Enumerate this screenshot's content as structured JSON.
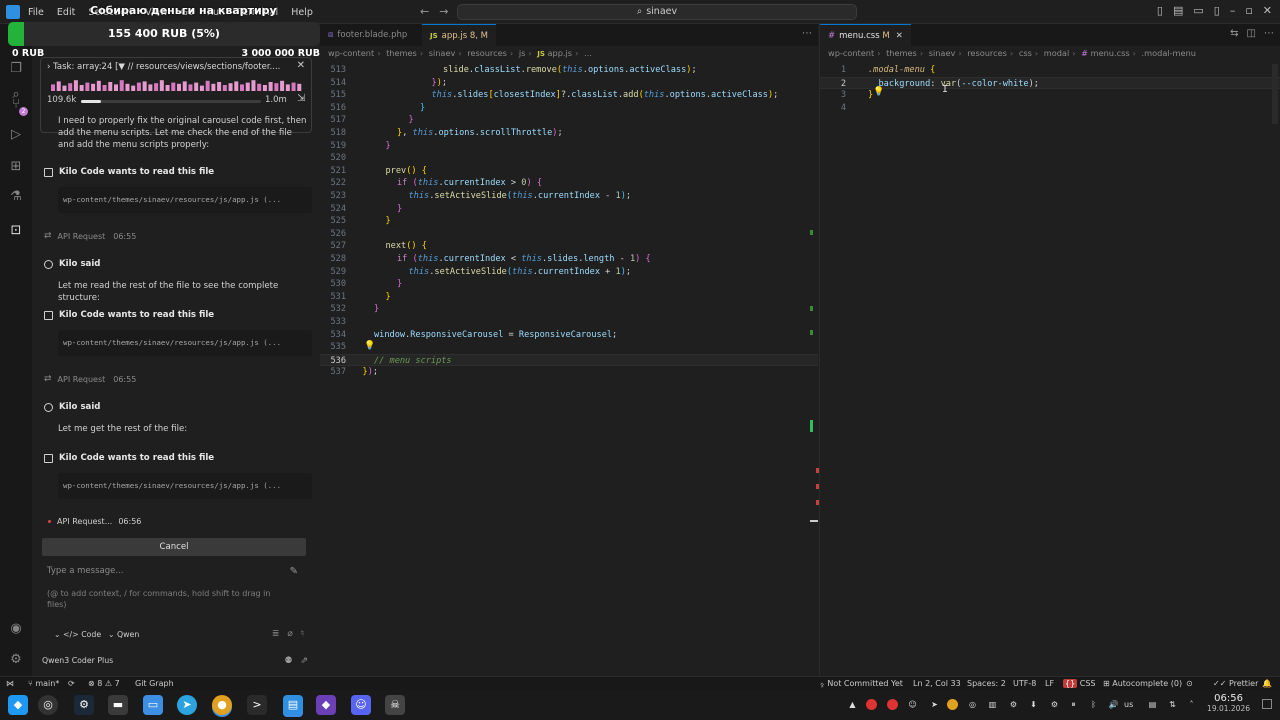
{
  "titlebar": {
    "menu": [
      "File",
      "Edit",
      "Selection",
      "View",
      "Go",
      "Run",
      "Terminal",
      "Help"
    ],
    "search": "sinaev"
  },
  "donation": {
    "title": "Собираю деньги на квартиру",
    "amount": "155 400 RUB (5%)",
    "min": "0 RUB",
    "max": "3 000 000 RUB",
    "progress": 0.052,
    "color": "#23b33a"
  },
  "activitybar": {
    "icons": [
      "kilo-code-icon",
      "explorer-icon",
      "search-icon",
      "source-control-icon",
      "run-debug-icon",
      "extensions-icon",
      "testing-icon",
      "kilo-panel-icon",
      "account-icon",
      "settings-icon"
    ],
    "source_control_badge": "2"
  },
  "task": {
    "header": "Task: array:24 [▼ // resources/views/sections/footer....",
    "context_min": "109.6k",
    "context_max": "1.0m",
    "context_fraction": 0.11,
    "histogram": [
      0.55,
      0.8,
      0.45,
      0.65,
      0.9,
      0.5,
      0.7,
      0.6,
      0.85,
      0.5,
      0.75,
      0.55,
      0.9,
      0.6,
      0.45,
      0.7,
      0.8,
      0.55,
      0.65,
      0.9,
      0.5,
      0.7,
      0.6,
      0.8,
      0.55,
      0.7,
      0.45,
      0.85,
      0.6,
      0.75,
      0.5,
      0.65,
      0.8,
      0.55,
      0.7,
      0.9,
      0.6,
      0.5,
      0.75,
      0.65,
      0.85,
      0.55,
      0.7,
      0.6
    ]
  },
  "chat": {
    "intro": "I need to properly fix the original carousel code first, then add the menu scripts. Let me check the end of the file and add the menu scripts properly:",
    "read_file_label": "Kilo Code wants to read this file",
    "kilo_said": "Kilo said",
    "api_request": "API Request",
    "path": "wp-content/themes/sinaev/resources/js/app.js (...",
    "time1": "06:55",
    "time2": "06:55",
    "msg1": "Let me read the rest of the file to see the complete structure:",
    "msg2": "Let me get the rest of the file:",
    "pending": "API Request...",
    "time3": "06:56",
    "cancel": "Cancel",
    "placeholder": "Type a message...",
    "hint": "(@ to add context, / for commands, hold shift to drag in files)",
    "mode": "Code",
    "model_short": "Qwen",
    "model_full": "Qwen3 Coder Plus"
  },
  "editor1": {
    "tabs": [
      {
        "name": "footer.blade.php",
        "active": false
      },
      {
        "name": "app.js",
        "status": "8, M",
        "active": true
      }
    ],
    "crumbs": [
      "wp-content",
      "themes",
      "sinaev",
      "resources",
      "js",
      "app.js",
      "..."
    ],
    "lines": [
      {
        "n": "513",
        "indent": 6,
        "parts": [
          [
            "fn",
            "slide"
          ],
          [
            "op",
            "."
          ],
          [
            "pr",
            "classList"
          ],
          [
            "op",
            "."
          ],
          [
            "fn",
            "remove"
          ],
          [
            "yel",
            "("
          ],
          [
            "th",
            "this"
          ],
          [
            "op",
            "."
          ],
          [
            "pr",
            "options"
          ],
          [
            "op",
            "."
          ],
          [
            "pr",
            "activeClass"
          ],
          [
            "yel",
            ")"
          ],
          [
            "op",
            ";"
          ]
        ]
      },
      {
        "n": "514",
        "indent": 5,
        "parts": [
          [
            "pink",
            "}"
          ],
          [
            "yel",
            ")"
          ],
          [
            "op",
            ";"
          ]
        ]
      },
      {
        "n": "515",
        "indent": 5,
        "parts": [
          [
            "th",
            "this"
          ],
          [
            "op",
            "."
          ],
          [
            "pr",
            "slides"
          ],
          [
            "yel",
            "["
          ],
          [
            "pr",
            "closestIndex"
          ],
          [
            "yel",
            "]"
          ],
          [
            "op",
            "?."
          ],
          [
            "pr",
            "classList"
          ],
          [
            "op",
            "."
          ],
          [
            "fn",
            "add"
          ],
          [
            "yel",
            "("
          ],
          [
            "th",
            "this"
          ],
          [
            "op",
            "."
          ],
          [
            "pr",
            "options"
          ],
          [
            "op",
            "."
          ],
          [
            "pr",
            "activeClass"
          ],
          [
            "yel",
            ")"
          ],
          [
            "op",
            ";"
          ]
        ]
      },
      {
        "n": "516",
        "indent": 4,
        "parts": [
          [
            "blue",
            "}"
          ]
        ]
      },
      {
        "n": "517",
        "indent": 3,
        "parts": [
          [
            "pink",
            "}"
          ]
        ]
      },
      {
        "n": "518",
        "indent": 2,
        "parts": [
          [
            "yel",
            "}"
          ],
          [
            "op",
            ", "
          ],
          [
            "th",
            "this"
          ],
          [
            "op",
            "."
          ],
          [
            "pr",
            "options"
          ],
          [
            "op",
            "."
          ],
          [
            "pr",
            "scrollThrottle"
          ],
          [
            "pink",
            ")"
          ],
          [
            "op",
            ";"
          ]
        ]
      },
      {
        "n": "519",
        "indent": 1,
        "parts": [
          [
            "pink",
            "}"
          ]
        ]
      },
      {
        "n": "520",
        "indent": 0,
        "parts": []
      },
      {
        "n": "521",
        "indent": 1,
        "parts": [
          [
            "fn",
            "prev"
          ],
          [
            "yel",
            "()"
          ],
          [
            "op",
            " "
          ],
          [
            "yel",
            "{"
          ]
        ]
      },
      {
        "n": "522",
        "indent": 2,
        "parts": [
          [
            "kw",
            "if"
          ],
          [
            "op",
            " "
          ],
          [
            "pink",
            "("
          ],
          [
            "th",
            "this"
          ],
          [
            "op",
            "."
          ],
          [
            "pr",
            "currentIndex"
          ],
          [
            "op",
            " > "
          ],
          [
            "num",
            "0"
          ],
          [
            "pink",
            ")"
          ],
          [
            "op",
            " "
          ],
          [
            "pink",
            "{"
          ]
        ]
      },
      {
        "n": "523",
        "indent": 3,
        "parts": [
          [
            "th",
            "this"
          ],
          [
            "op",
            "."
          ],
          [
            "fn",
            "setActiveSlide"
          ],
          [
            "blue",
            "("
          ],
          [
            "th",
            "this"
          ],
          [
            "op",
            "."
          ],
          [
            "pr",
            "currentIndex"
          ],
          [
            "op",
            " - "
          ],
          [
            "num",
            "1"
          ],
          [
            "blue",
            ")"
          ],
          [
            "op",
            ";"
          ]
        ]
      },
      {
        "n": "524",
        "indent": 2,
        "parts": [
          [
            "pink",
            "}"
          ]
        ]
      },
      {
        "n": "525",
        "indent": 1,
        "parts": [
          [
            "yel",
            "}"
          ]
        ]
      },
      {
        "n": "526",
        "indent": 0,
        "parts": []
      },
      {
        "n": "527",
        "indent": 1,
        "parts": [
          [
            "fn",
            "next"
          ],
          [
            "yel",
            "()"
          ],
          [
            "op",
            " "
          ],
          [
            "yel",
            "{"
          ]
        ]
      },
      {
        "n": "528",
        "indent": 2,
        "parts": [
          [
            "kw",
            "if"
          ],
          [
            "op",
            " "
          ],
          [
            "pink",
            "("
          ],
          [
            "th",
            "this"
          ],
          [
            "op",
            "."
          ],
          [
            "pr",
            "currentIndex"
          ],
          [
            "op",
            " < "
          ],
          [
            "th",
            "this"
          ],
          [
            "op",
            "."
          ],
          [
            "pr",
            "slides"
          ],
          [
            "op",
            "."
          ],
          [
            "pr",
            "length"
          ],
          [
            "op",
            " - "
          ],
          [
            "num",
            "1"
          ],
          [
            "pink",
            ")"
          ],
          [
            "op",
            " "
          ],
          [
            "pink",
            "{"
          ]
        ]
      },
      {
        "n": "529",
        "indent": 3,
        "parts": [
          [
            "th",
            "this"
          ],
          [
            "op",
            "."
          ],
          [
            "fn",
            "setActiveSlide"
          ],
          [
            "blue",
            "("
          ],
          [
            "th",
            "this"
          ],
          [
            "op",
            "."
          ],
          [
            "pr",
            "currentIndex"
          ],
          [
            "op",
            " + "
          ],
          [
            "num",
            "1"
          ],
          [
            "blue",
            ")"
          ],
          [
            "op",
            ";"
          ]
        ]
      },
      {
        "n": "530",
        "indent": 2,
        "parts": [
          [
            "pink",
            "}"
          ]
        ]
      },
      {
        "n": "531",
        "indent": 1,
        "parts": [
          [
            "yel",
            "}"
          ]
        ]
      },
      {
        "n": "532",
        "indent": 0,
        "parts": [
          [
            "pink",
            "}"
          ]
        ]
      },
      {
        "n": "533",
        "indent": 0,
        "parts": []
      },
      {
        "n": "534",
        "indent": 0,
        "parts": [
          [
            "pr",
            "window"
          ],
          [
            "op",
            "."
          ],
          [
            "pr",
            "ResponsiveCarousel"
          ],
          [
            "op",
            " = "
          ],
          [
            "pr",
            "ResponsiveCarousel"
          ],
          [
            "op",
            ";"
          ]
        ]
      },
      {
        "n": "535",
        "indent": 0,
        "parts": []
      },
      {
        "n": "536",
        "indent": 0,
        "parts": [
          [
            "cm",
            "// menu scripts"
          ]
        ],
        "current": true
      },
      {
        "n": "537",
        "indent": -1,
        "parts": [
          [
            "yel",
            "}"
          ],
          [
            "pink",
            ")"
          ],
          [
            "op",
            ";"
          ]
        ]
      }
    ]
  },
  "editor2": {
    "tabs": [
      {
        "name": "menu.css",
        "status": "M",
        "active": true
      }
    ],
    "crumbs": [
      "wp-content",
      "themes",
      "sinaev",
      "resources",
      "css",
      "modal",
      "menu.css",
      ".modal-menu"
    ],
    "lines": [
      {
        "n": "1",
        "indent": 0,
        "parts": [
          [
            "sel",
            ".modal-menu"
          ],
          [
            "op",
            " "
          ],
          [
            "yel",
            "{"
          ]
        ]
      },
      {
        "n": "2",
        "indent": 1,
        "parts": [
          [
            "cssp",
            "background"
          ],
          [
            "op",
            ": "
          ],
          [
            "var",
            "var"
          ],
          [
            "op",
            "("
          ],
          [
            "cssp",
            "--color-white"
          ],
          [
            "op",
            ")"
          ],
          [
            "op",
            ";"
          ]
        ],
        "current": true
      },
      {
        "n": "3",
        "indent": 0,
        "parts": [
          [
            "yel",
            "}"
          ]
        ]
      },
      {
        "n": "4",
        "indent": 0,
        "parts": []
      }
    ]
  },
  "status": {
    "branch": "main*",
    "errors": "8",
    "warnings": "7",
    "git_graph": "Git Graph",
    "not_committed": "Not Committed Yet",
    "position": "Ln 2, Col 33",
    "spaces": "Spaces: 2",
    "encoding": "UTF-8",
    "eol": "LF",
    "language": "CSS",
    "autocomplete": "Autocomplete (0)",
    "prettier": "Prettier"
  },
  "taskbar": {
    "apps": [
      "kde-icon",
      "obs-icon",
      "steam-icon",
      "terminal-icon",
      "files-icon",
      "telegram-icon",
      "chrome-icon",
      "konsole-icon",
      "vscode-icon",
      "obsidian-icon",
      "discord-icon",
      "game-icon"
    ],
    "keyboard": "us",
    "time": "06:56",
    "date": "19.01.2026"
  }
}
